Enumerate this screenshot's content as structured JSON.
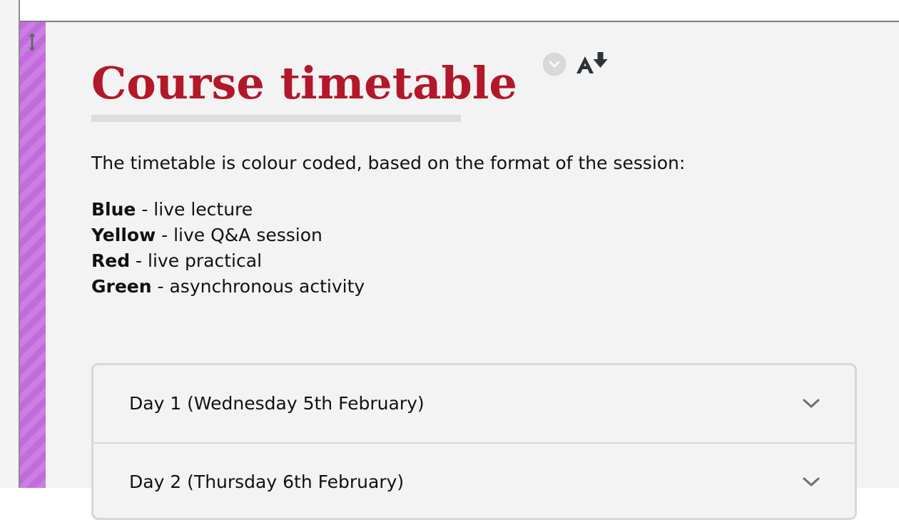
{
  "window": {
    "drag_handle_icon": "vertical-resize-icon"
  },
  "theme": {
    "title_color": "#b3172a",
    "rail_color": "#c36bdc",
    "content_background": "#f3f3f3"
  },
  "header": {
    "title": "Course timetable",
    "options_icon": "chevron-down-circle-icon",
    "alt_formats_icon": "alternative-formats-download-icon"
  },
  "intro": {
    "text": "The timetable is colour coded, based on the format of the session:"
  },
  "legend": {
    "items": [
      {
        "key": "Blue",
        "description": " - live lecture"
      },
      {
        "key": "Yellow",
        "description": " - live Q&A session"
      },
      {
        "key": "Red",
        "description": " - live practical"
      },
      {
        "key": "Green",
        "description": " - asynchronous activity"
      }
    ]
  },
  "accordion": {
    "items": [
      {
        "label": "Day 1 (Wednesday 5th February)",
        "icon": "chevron-down-icon"
      },
      {
        "label": "Day 2 (Thursday 6th February)",
        "icon": "chevron-down-icon"
      }
    ]
  }
}
